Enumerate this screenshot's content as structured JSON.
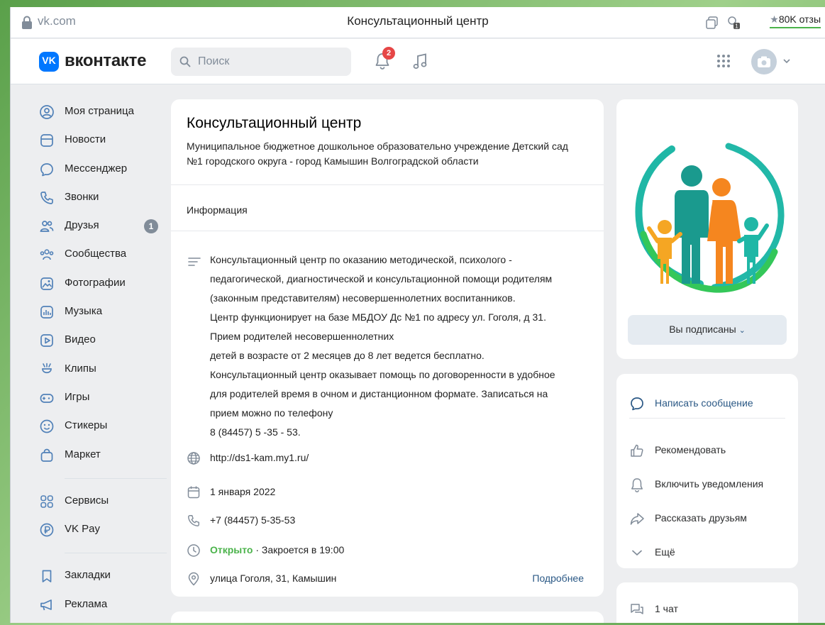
{
  "browser": {
    "url": "vk.com",
    "tab_title": "Консультационный центр",
    "rating": "80K отзы"
  },
  "header": {
    "brand": "вконтакте",
    "logo_text": "VK",
    "search_placeholder": "Поиск",
    "notifications_count": "2"
  },
  "nav": {
    "items": [
      {
        "label": "Моя страница",
        "icon": "user-circle-icon"
      },
      {
        "label": "Новости",
        "icon": "newsfeed-icon"
      },
      {
        "label": "Мессенджер",
        "icon": "message-icon"
      },
      {
        "label": "Звонки",
        "icon": "phone-icon"
      },
      {
        "label": "Друзья",
        "icon": "friends-icon",
        "badge": "1"
      },
      {
        "label": "Сообщества",
        "icon": "communities-icon"
      },
      {
        "label": "Фотографии",
        "icon": "photos-icon"
      },
      {
        "label": "Музыка",
        "icon": "music-icon"
      },
      {
        "label": "Видео",
        "icon": "video-icon"
      },
      {
        "label": "Клипы",
        "icon": "clips-icon"
      },
      {
        "label": "Игры",
        "icon": "gamepad-icon"
      },
      {
        "label": "Стикеры",
        "icon": "sticker-icon"
      },
      {
        "label": "Маркет",
        "icon": "market-bag-icon"
      }
    ],
    "items2": [
      {
        "label": "Сервисы",
        "icon": "services-icon"
      },
      {
        "label": "VK Pay",
        "icon": "vkpay-icon"
      }
    ],
    "items3": [
      {
        "label": "Закладки",
        "icon": "bookmark-icon"
      },
      {
        "label": "Реклама",
        "icon": "megaphone-icon"
      }
    ]
  },
  "group": {
    "title": "Консультационный центр",
    "subtitle": "Муниципальное бюджетное дошкольное образовательно учреждение Детский сад №1 городского округа - город Камышин Волгоградской области",
    "info_header": "Информация",
    "description_lines": [
      "Консультационный центр по оказанию методической, психолого -",
      "педагогической, диагностической и консультационной помощи родителям",
      "(законным представителям) несовершеннолетних воспитанников.",
      "Центр функционирует на базе МБДОУ Дс №1 по адресу ул. Гоголя, д 31.",
      "Прием родителей несовершеннолетних",
      "детей в возрасте от 2 месяцев до 8 лет ведется бесплатно.",
      "Консультационный центр оказывает помощь по договоренности в удобное",
      "для родителей время в очном и дистанционном формате. Записаться на",
      "прием можно по телефону",
      "8 (84457) 5 -35 - 53."
    ],
    "website": "http://ds1-kam.my1.ru/",
    "date": "1 января 2022",
    "phone": "+7 (84457) 5-35-53",
    "status_open": "Открыто",
    "status_close": " · Закроется в 19:00",
    "address": "улица Гоголя, 31, Камышин",
    "more": "Подробнее"
  },
  "side": {
    "subscribed": "Вы подписаны",
    "actions": [
      {
        "label": "Написать сообщение",
        "icon": "message-icon"
      },
      {
        "label": "Рекомендовать",
        "icon": "thumbs-up-icon"
      },
      {
        "label": "Включить уведомления",
        "icon": "bell-icon"
      },
      {
        "label": "Рассказать друзьям",
        "icon": "share-icon"
      },
      {
        "label": "Ещё",
        "icon": "chevron-down-icon"
      }
    ],
    "chat": "1 чат"
  },
  "colors": {
    "accent": "#0077ff",
    "link": "#2a5885",
    "open": "#4bb34b",
    "badge_red": "#e64646",
    "logo_teal": "#1fb7a6",
    "logo_green": "#34c759",
    "logo_orange": "#f5861f",
    "logo_figure_teal": "#1a9a8e"
  }
}
